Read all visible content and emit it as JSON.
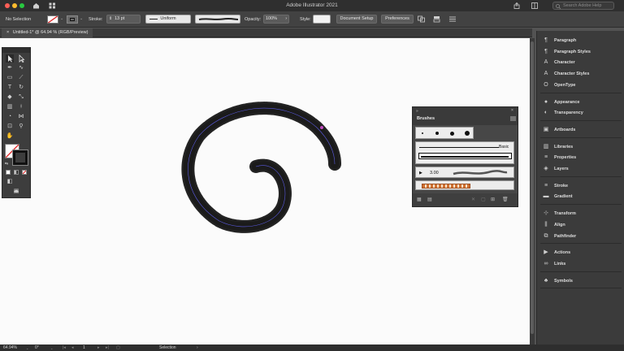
{
  "app": {
    "title": "Adobe Illustrator 2021",
    "help_placeholder": "Search Adobe Help"
  },
  "control_bar": {
    "selection_label": "No Selection",
    "stroke_label": "Stroke:",
    "stroke_value": "13 pt",
    "profile_value": "Uniform",
    "opacity_label": "Opacity:",
    "opacity_value": "100%",
    "style_label": "Style:",
    "document_setup": "Document Setup",
    "preferences": "Preferences"
  },
  "document_tab": {
    "label": "Untitled-1* @ 64.94 % (RGB/Preview)"
  },
  "status_bar": {
    "zoom": "64.94%",
    "rotation": "0°",
    "artboard": "1",
    "tool": "Selection"
  },
  "dock": {
    "groups": [
      [
        {
          "label": "Paragraph",
          "icon": "paragraph-icon"
        },
        {
          "label": "Paragraph Styles",
          "icon": "paragraph-styles-icon"
        },
        {
          "label": "Character",
          "icon": "character-icon"
        },
        {
          "label": "Character Styles",
          "icon": "character-styles-icon"
        },
        {
          "label": "OpenType",
          "icon": "opentype-icon"
        }
      ],
      [
        {
          "label": "Appearance",
          "icon": "appearance-icon"
        },
        {
          "label": "Transparency",
          "icon": "transparency-icon"
        }
      ],
      [
        {
          "label": "Artboards",
          "icon": "artboards-icon"
        }
      ],
      [
        {
          "label": "Libraries",
          "icon": "libraries-icon"
        },
        {
          "label": "Properties",
          "icon": "properties-icon"
        },
        {
          "label": "Layers",
          "icon": "layers-icon"
        }
      ],
      [
        {
          "label": "Stroke",
          "icon": "stroke-icon"
        },
        {
          "label": "Gradient",
          "icon": "gradient-icon"
        }
      ],
      [
        {
          "label": "Transform",
          "icon": "transform-icon"
        },
        {
          "label": "Align",
          "icon": "align-icon"
        },
        {
          "label": "Pathfinder",
          "icon": "pathfinder-icon"
        }
      ],
      [
        {
          "label": "Actions",
          "icon": "actions-icon"
        },
        {
          "label": "Links",
          "icon": "links-icon"
        }
      ],
      [
        {
          "label": "Symbols",
          "icon": "symbols-icon"
        }
      ]
    ]
  },
  "brushes_panel": {
    "title": "Brushes",
    "basic_label": "Basic",
    "size_value": "3.00"
  },
  "colors": {
    "accent": "#1473e6",
    "path_guide": "#5a5ae0",
    "canvas": "#fbfbfb"
  }
}
